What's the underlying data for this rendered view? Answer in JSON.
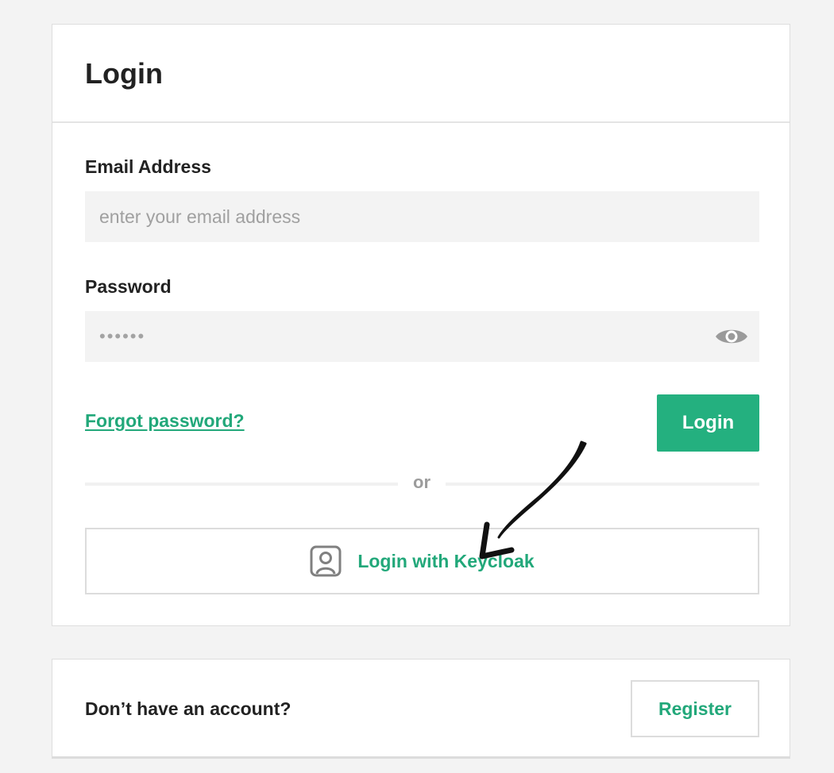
{
  "login_card": {
    "title": "Login",
    "email": {
      "label": "Email Address",
      "placeholder": "enter your email address",
      "value": ""
    },
    "password": {
      "label": "Password",
      "value": "••••••",
      "toggle_icon": "eye-icon"
    },
    "forgot_password_label": "Forgot password?",
    "login_button_label": "Login",
    "divider_text": "or",
    "keycloak_button": {
      "label": "Login with Keycloak",
      "icon": "user-portrait-icon"
    }
  },
  "register_card": {
    "prompt": "Don’t have an account?",
    "register_button_label": "Register"
  },
  "colors": {
    "accent": "#24b07f",
    "link": "#22a87a",
    "page_background": "#f3f3f3",
    "input_background": "#f3f3f3"
  }
}
